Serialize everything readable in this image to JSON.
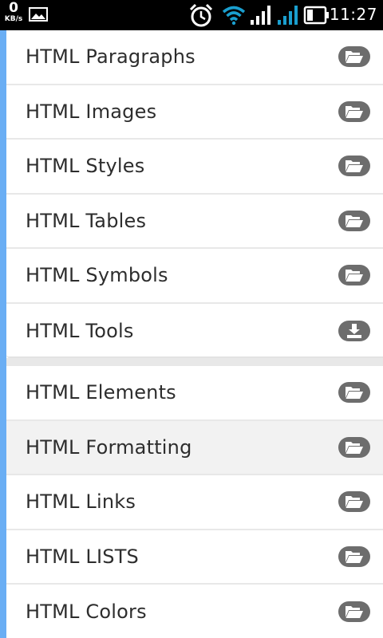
{
  "status_bar": {
    "speed_value": "0",
    "speed_unit": "KB/s",
    "time": "11:27",
    "icons": [
      "image-icon",
      "alarm-icon",
      "wifi-icon",
      "signal-icon",
      "signal-icon",
      "battery-icon"
    ],
    "colors": {
      "wifi": "#1a9fcf",
      "signal_accent": "#1a9fcf"
    }
  },
  "accent_color": "#6aaef4",
  "group1": {
    "items": [
      {
        "label": "HTML Paragraphs",
        "icon": "folder-open-icon"
      },
      {
        "label": "HTML Images",
        "icon": "folder-open-icon"
      },
      {
        "label": "HTML Styles",
        "icon": "folder-open-icon"
      },
      {
        "label": "HTML Tables",
        "icon": "folder-open-icon"
      },
      {
        "label": "HTML Symbols",
        "icon": "folder-open-icon"
      },
      {
        "label": "HTML Tools",
        "icon": "download-icon"
      }
    ]
  },
  "group2": {
    "items": [
      {
        "label": "HTML Elements",
        "icon": "folder-open-icon"
      },
      {
        "label": "HTML Formatting",
        "icon": "folder-open-icon",
        "pressed": true
      },
      {
        "label": "HTML Links",
        "icon": "folder-open-icon"
      },
      {
        "label": "HTML LISTS",
        "icon": "folder-open-icon"
      },
      {
        "label": "HTML Colors",
        "icon": "folder-open-icon"
      }
    ]
  }
}
